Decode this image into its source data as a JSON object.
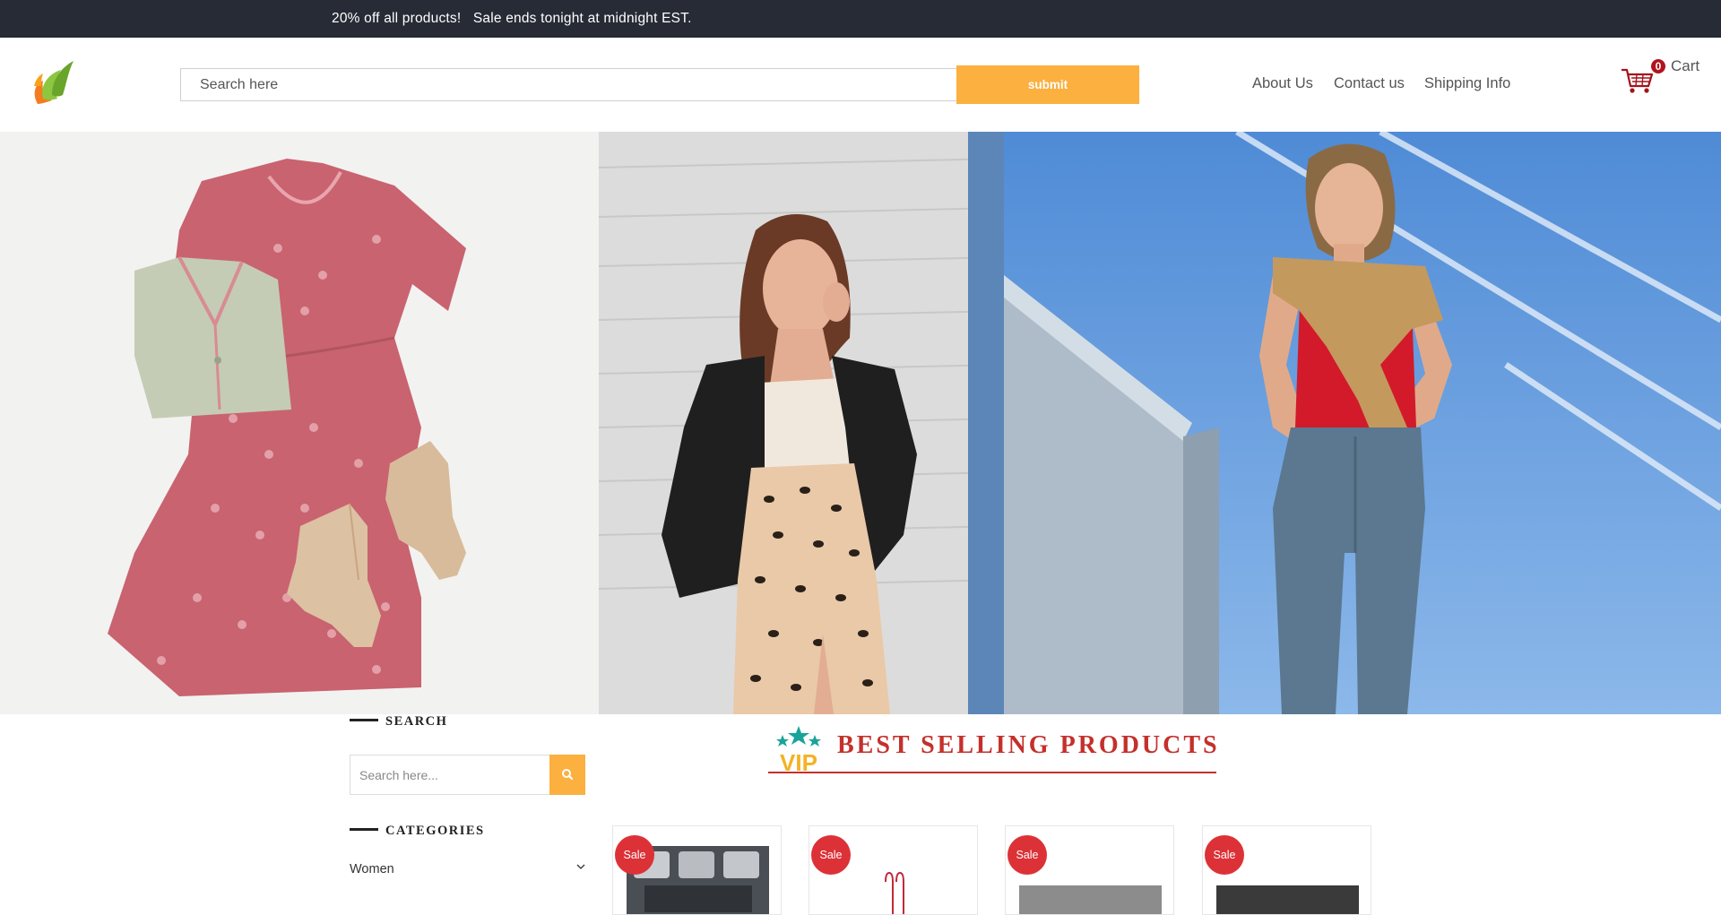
{
  "announcement": {
    "text": "20% off all products!   Sale ends tonight at midnight EST."
  },
  "header": {
    "search_placeholder": "Search here",
    "submit_label": "submit",
    "nav": [
      {
        "label": "About Us"
      },
      {
        "label": "Contact us"
      },
      {
        "label": "Shipping Info"
      }
    ],
    "cart": {
      "count": "0",
      "label": "Cart"
    }
  },
  "sidebar": {
    "search_heading": "SEARCH",
    "search_placeholder": "Search here...",
    "categories_heading": "CATEGORIES",
    "categories": [
      {
        "label": "Women"
      }
    ]
  },
  "best_selling": {
    "title": "BEST SELLING PRODUCTS",
    "badge_text": "VIP"
  },
  "products": [
    {
      "badge": "Sale"
    },
    {
      "badge": "Sale"
    },
    {
      "badge": "Sale"
    },
    {
      "badge": "Sale"
    }
  ],
  "colors": {
    "topbar": "#262b35",
    "accent": "#fbb040",
    "sale_badge": "#dc3237",
    "heading_red": "#c4302b",
    "cart_badge": "#b0141e"
  },
  "icons": {
    "logo": "leaf-flame-logo",
    "cart": "shopping-cart-icon",
    "search": "search-icon",
    "chevron": "chevron-down-icon",
    "vip": "vip-stars-icon"
  }
}
